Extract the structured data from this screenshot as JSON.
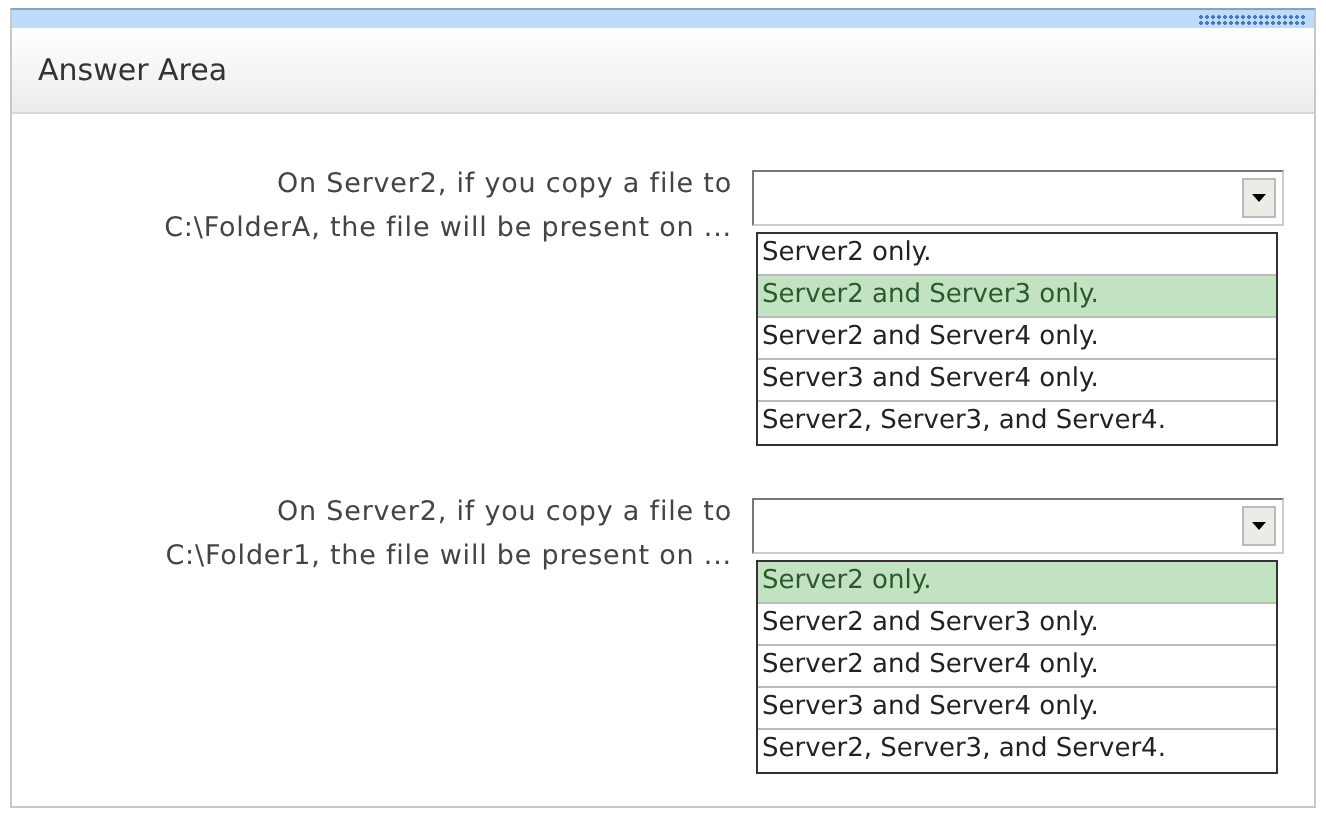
{
  "header": {
    "title": "Answer Area"
  },
  "questions": [
    {
      "prompt_lines": [
        "On Server2, if you copy a file to",
        "C:\\FolderA, the file will be present on ..."
      ],
      "options": [
        {
          "label": "Server2 only.",
          "selected": false
        },
        {
          "label": "Server2 and Server3 only.",
          "selected": true
        },
        {
          "label": "Server2 and Server4 only.",
          "selected": false
        },
        {
          "label": "Server3 and Server4 only.",
          "selected": false
        },
        {
          "label": "Server2, Server3, and Server4.",
          "selected": false
        }
      ]
    },
    {
      "prompt_lines": [
        "On Server2, if you copy a file to",
        "C:\\Folder1, the file will be present on ..."
      ],
      "options": [
        {
          "label": "Server2 only.",
          "selected": true
        },
        {
          "label": "Server2 and Server3 only.",
          "selected": false
        },
        {
          "label": "Server2 and Server4 only.",
          "selected": false
        },
        {
          "label": "Server3 and Server4 only.",
          "selected": false
        },
        {
          "label": "Server2, Server3, and Server4.",
          "selected": false
        }
      ]
    }
  ]
}
